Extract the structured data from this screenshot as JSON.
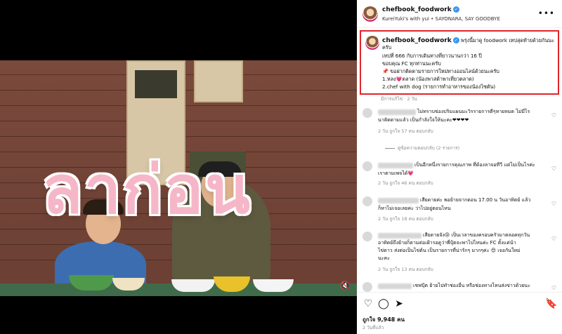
{
  "post": {
    "username": "chefbook_foodwork",
    "audio": "KureiYuki's with yui • SAYONARA, SAY GOODBYE",
    "more_label": "•••"
  },
  "media": {
    "overlay_text": "ลาก่อน",
    "mute_icon": "speaker-muted-icon"
  },
  "caption": {
    "username": "chefbook_foodwork",
    "lines": [
      "พรุ่งนี้มาดู foodwork เทปสุดท้ายด้วยกันนะ",
      "ครับ",
      "เทปที่ 666 กับการเดินทางที่ยาวนานกว่า 16 ปี",
      "ขอบคุณ FC ทุกท่านนะครับ",
      "📌 ขอฝากติดตามรายการใหม่ทางออนไลน์ด้วยนะครับ",
      "1.หลง💗ตลาด (น้องพาสต้าพาเที่ยวตลาด)",
      "2.chef with dog (รายการทำอาหารของน้องไซตัน)"
    ],
    "edited": "มีการแก้ไข · 2 วัน"
  },
  "comments": [
    {
      "lines": [
        "ไม่ทราบข่องปริมแผนมะวิรรายการดีๆหายหมด ไม่มีไร",
        "นาติดตามแล้ว เป็นกำลังใจให้นะคะ❤❤❤❤"
      ],
      "meta": "2 วัน   ถูกใจ 57 คน   ตอบกลับ",
      "replies": "ดูข้อความตอบกลับ (2 รายการ)"
    },
    {
      "lines": [
        "เป็นอีกหนึ่งรายการคุณภาพ ที่ต้องลาจอทีวี แต่ไม่เป็นไรค่ะ",
        "เราตามเพจได้💗"
      ],
      "meta": "2 วัน   ถูกใจ 46 คน   ตอบกลับ"
    },
    {
      "lines": [
        "เสียดายค่ะ พอย้ายจากตอน 17.00 น วันอาทิตย์ แล้ว",
        "ก็หาไม่เจอเลยค่ะ ว่าไปอยู่ตอนไหน"
      ],
      "meta": "2 วัน   ถูกใจ 18 คน   ตอบกลับ"
    },
    {
      "lines": [
        "เสียดายจัง😢 เป็นเวลาของครอบครัวมาตลอดทุกวัน",
        "อาทิตย์ถึงย้ายก็ตามต่อเฝ้ารอดูว่าพี่ปุ้ตจะพาไปไหนค่ะ FC ตั้งแต่น้า",
        "ไข่ดาว ส่งต่อเป็นไข่ต้น เป็นรายการที่น่ารักๆ มากๆค่ะ 😍 เจอกันใหม่",
        "นะคะ"
      ],
      "meta": "2 วัน   ถูกใจ 13 คน   ตอบกลับ"
    },
    {
      "lines": [
        "เชฟปุ้ต ย้ายไปทำช่องอื่น หรือช่องทางไหนส่งข่าวด้วยนะ"
      ],
      "meta": ""
    }
  ],
  "footer": {
    "likes": "ถูกใจ 9,948 คน",
    "ago": "2 วันที่แล้ว",
    "icons": [
      "heart-icon",
      "comment-icon",
      "share-icon",
      "save-icon"
    ]
  }
}
